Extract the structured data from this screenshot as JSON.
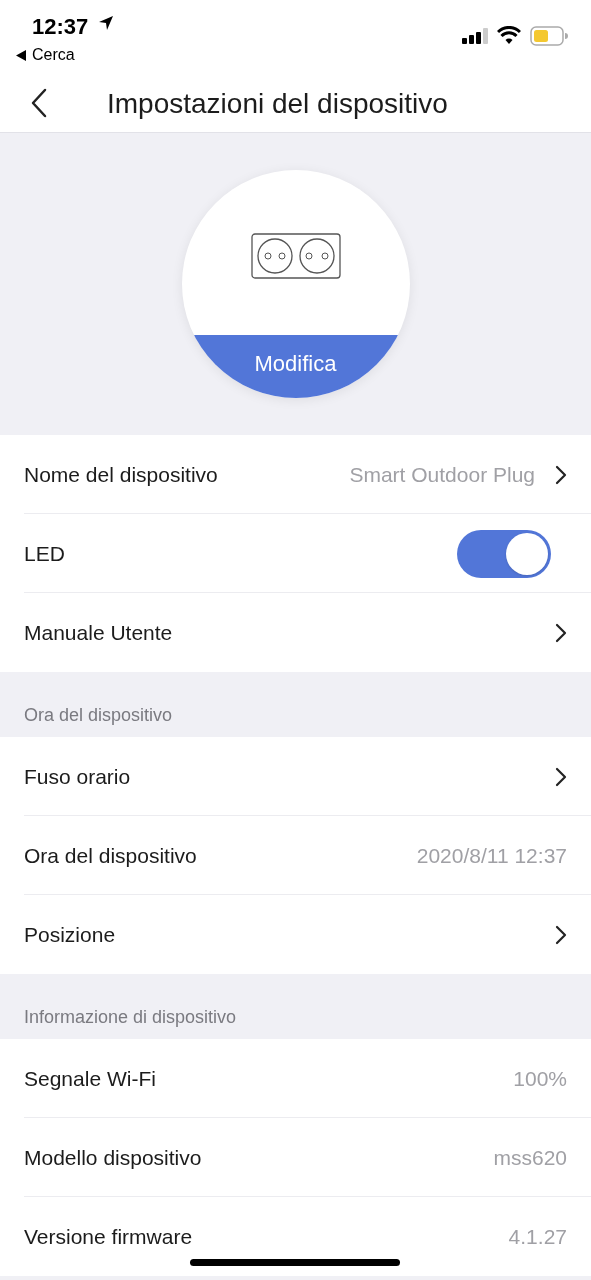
{
  "status_bar": {
    "time": "12:37",
    "back_app": "Cerca"
  },
  "nav": {
    "title": "Impostazioni del dispositivo"
  },
  "device": {
    "edit_label": "Modifica"
  },
  "sections": [
    {
      "rows": [
        {
          "kind": "link",
          "label": "Nome del dispositivo",
          "value": "Smart Outdoor Plug"
        },
        {
          "kind": "toggle",
          "label": "LED",
          "on": true
        },
        {
          "kind": "link",
          "label": "Manuale Utente"
        }
      ]
    },
    {
      "header": "Ora del dispositivo",
      "rows": [
        {
          "kind": "link",
          "label": "Fuso orario"
        },
        {
          "kind": "value",
          "label": "Ora del dispositivo",
          "value": "2020/8/11 12:37"
        },
        {
          "kind": "link",
          "label": "Posizione"
        }
      ]
    },
    {
      "header": "Informazione di dispositivo",
      "rows": [
        {
          "kind": "value",
          "label": "Segnale Wi-Fi",
          "value": "100%"
        },
        {
          "kind": "value",
          "label": "Modello dispositivo",
          "value": "mss620"
        },
        {
          "kind": "value",
          "label": "Versione firmware",
          "value": "4.1.27"
        }
      ]
    }
  ]
}
